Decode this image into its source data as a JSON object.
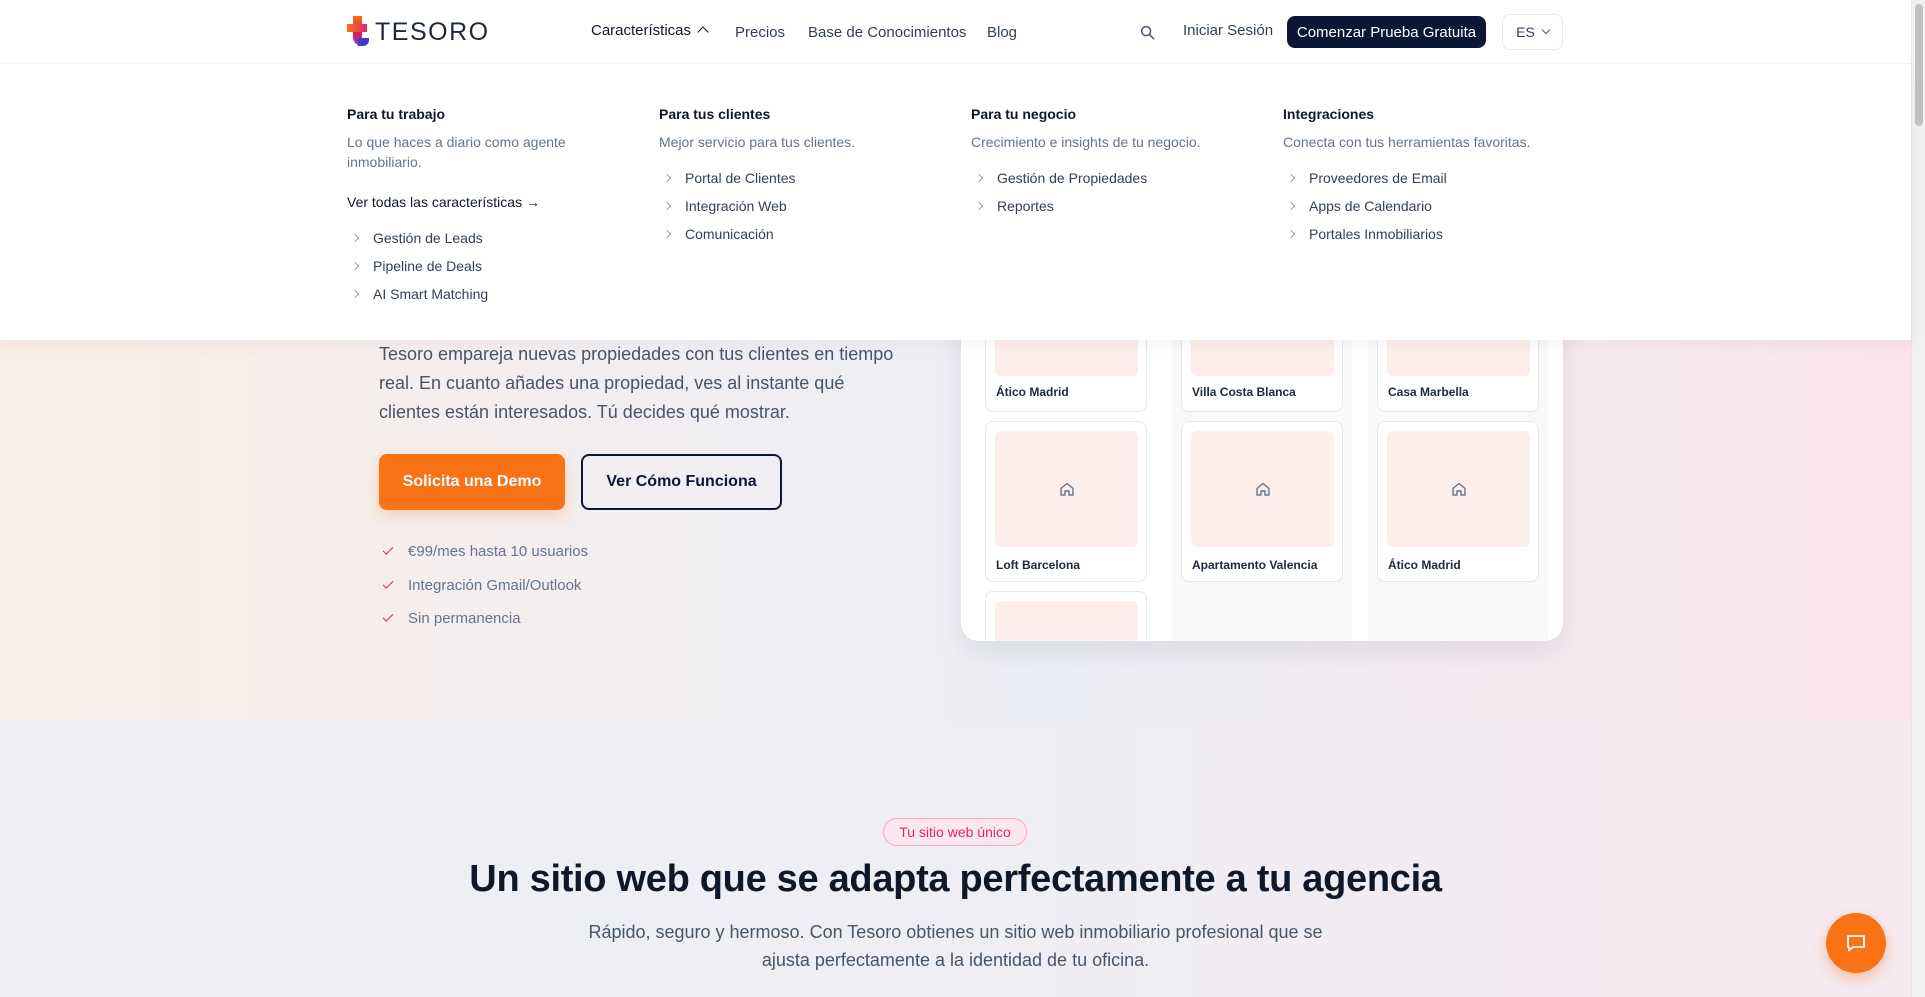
{
  "brand": {
    "name": "TESORO"
  },
  "nav": {
    "features": "Características",
    "prices": "Precios",
    "knowledge_base": "Base de Conocimientos",
    "blog": "Blog",
    "login": "Iniciar Sesión",
    "trial": "Comenzar Prueba Gratuita",
    "lang": "ES"
  },
  "mega_menu": {
    "work": {
      "title": "Para tu trabajo",
      "desc": "Lo que haces a diario como agente inmobiliario.",
      "see_all": "Ver todas las características →",
      "items": [
        "Gestión de Leads",
        "Pipeline de Deals",
        "AI Smart Matching"
      ]
    },
    "clients": {
      "title": "Para tus clientes",
      "desc": "Mejor servicio para tus clientes.",
      "items": [
        "Portal de Clientes",
        "Integración Web",
        "Comunicación"
      ]
    },
    "business": {
      "title": "Para tu negocio",
      "desc": "Crecimiento e insights de tu negocio.",
      "items": [
        "Gestión de Propiedades",
        "Reportes"
      ]
    },
    "integrations": {
      "title": "Integraciones",
      "desc": "Conecta con tus herramientas favoritas.",
      "items": [
        "Proveedores de Email",
        "Apps de Calendario",
        "Portales Inmobiliarios"
      ]
    }
  },
  "hero": {
    "text": "Tesoro empareja nuevas propiedades con tus clientes en tiempo real. En cuanto añades una propiedad, ves al instante qué clientes están interesados. Tú decides qué mostrar.",
    "demo_button": "Solicita una Demo",
    "how_button": "Ver Cómo Funciona",
    "checks": [
      "€99/mes hasta 10 usuarios",
      "Integración Gmail/Outlook",
      "Sin permanencia"
    ]
  },
  "mockup": {
    "row1": [
      "Ático Madrid",
      "Villa Costa Blanca",
      "Casa Marbella"
    ],
    "row2": [
      "Loft Barcelona",
      "Apartamento Valencia",
      "Ático Madrid"
    ]
  },
  "section2": {
    "badge": "Tu sitio web único",
    "title": "Un sitio web que se adapta perfectamente a tu agencia",
    "subtitle": "Rápido, seguro y hermoso. Con Tesoro obtienes un sitio web inmobiliario profesional que se ajusta perfectamente a la identidad de tu oficina."
  },
  "colors": {
    "accent": "#f97316",
    "navy": "#0b1736",
    "pink": "#db2777"
  }
}
